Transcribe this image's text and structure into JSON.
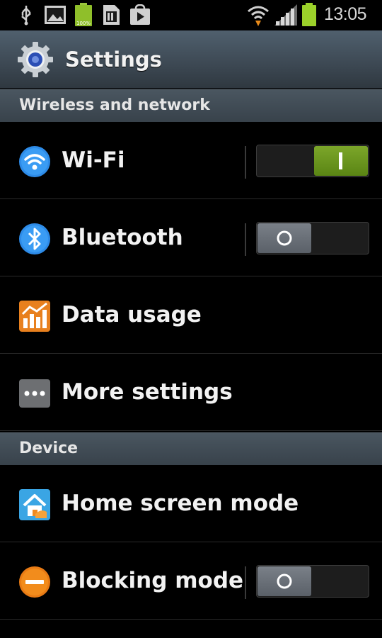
{
  "status_bar": {
    "time": "13:05",
    "battery_small": "100%"
  },
  "action_bar": {
    "title": "Settings"
  },
  "sections": {
    "wireless": {
      "title": "Wireless and network"
    },
    "device": {
      "title": "Device"
    }
  },
  "items": {
    "wifi": {
      "label": "Wi-Fi",
      "state": "on"
    },
    "bluetooth": {
      "label": "Bluetooth",
      "state": "off"
    },
    "data_usage": {
      "label": "Data usage"
    },
    "more_settings": {
      "label": "More settings"
    },
    "home_screen_mode": {
      "label": "Home screen mode"
    },
    "blocking_mode": {
      "label": "Blocking mode",
      "state": "off"
    }
  },
  "colors": {
    "toggle_on": "#6b9a1e",
    "toggle_off": "#6a7078",
    "action_bar": "#46535e",
    "section_header": "#3e4852"
  }
}
